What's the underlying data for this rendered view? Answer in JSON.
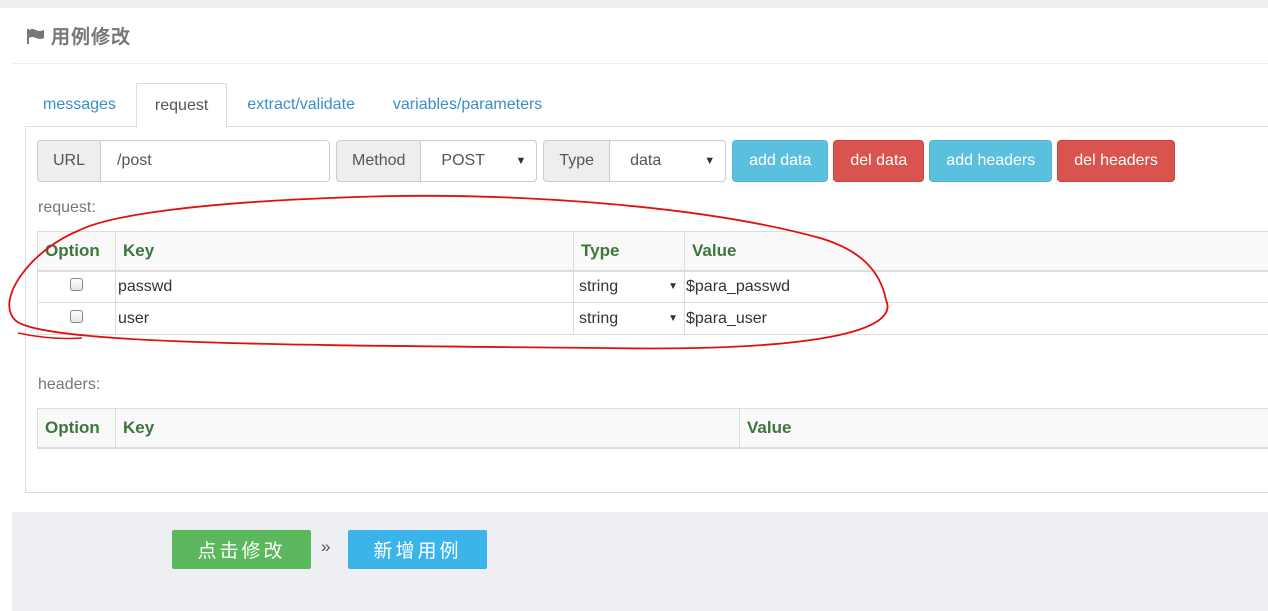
{
  "header": {
    "title": "用例修改"
  },
  "tabs": [
    {
      "label": "messages"
    },
    {
      "label": "request"
    },
    {
      "label": "extract/validate"
    },
    {
      "label": "variables/parameters"
    }
  ],
  "toolbar": {
    "url_label": "URL",
    "url_value": "/post",
    "method_label": "Method",
    "method_value": "POST",
    "type_label": "Type",
    "type_value": "data",
    "add_data": "add data",
    "del_data": "del data",
    "add_headers": "add headers",
    "del_headers": "del headers"
  },
  "request": {
    "label": "request:",
    "columns": [
      "Option",
      "Key",
      "Type",
      "Value"
    ],
    "rows": [
      {
        "key": "passwd",
        "type": "string",
        "value": "$para_passwd"
      },
      {
        "key": "user",
        "type": "string",
        "value": "$para_user"
      }
    ]
  },
  "headers": {
    "label": "headers:",
    "columns": [
      "Option",
      "Key",
      "Value"
    ]
  },
  "footer": {
    "submit": "点击修改",
    "separator": "»",
    "new_case": "新增用例"
  },
  "colors": {
    "info": "#5bc0de",
    "danger": "#d9534f",
    "success": "#5cb85c",
    "annotation": "#e01010"
  }
}
